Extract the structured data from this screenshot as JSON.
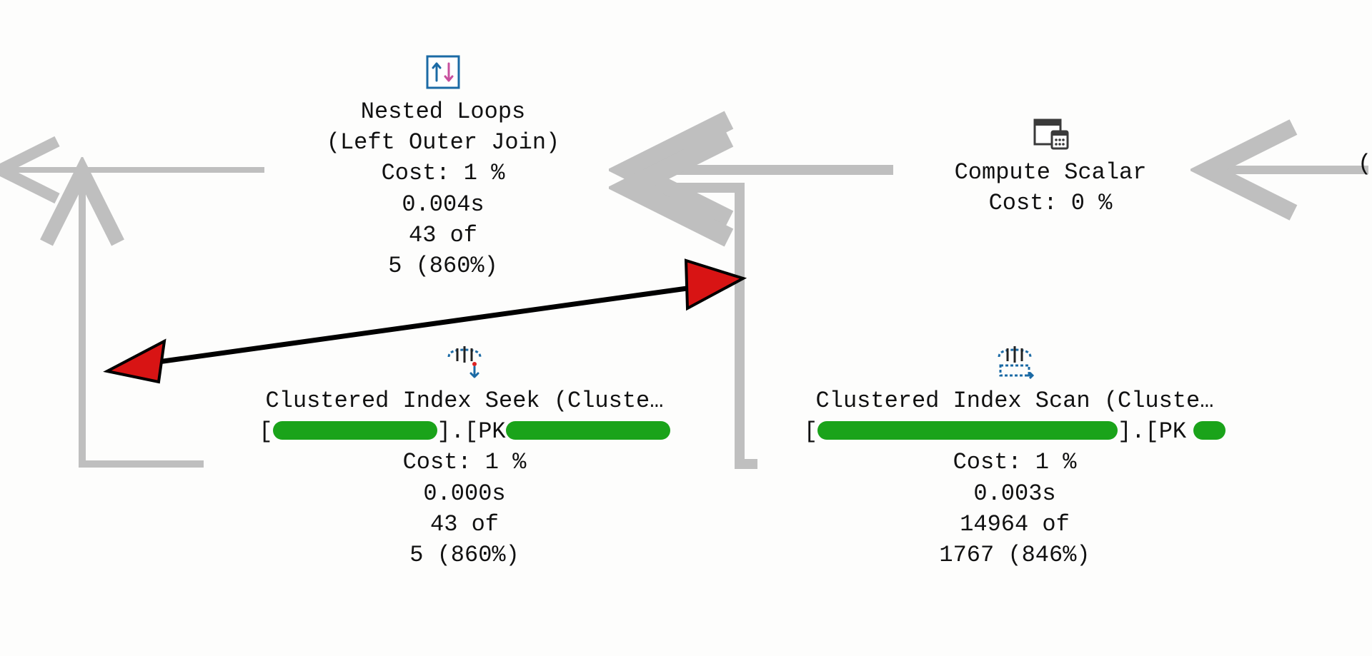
{
  "operators": {
    "nested_loops": {
      "title": "Nested Loops",
      "subtitle": "(Left Outer Join)",
      "cost": "Cost: 1 %",
      "time": "0.004s",
      "actual": "43 of",
      "estimate": "5 (860%)"
    },
    "compute_scalar": {
      "title": "Compute Scalar",
      "cost": "Cost: 0 %"
    },
    "index_seek": {
      "title": "Clustered Index Seek (Cluste…",
      "obj_prefix": "[",
      "obj_mid": "].[PK",
      "obj_suffix": "",
      "cost": "Cost: 1 %",
      "time": "0.000s",
      "actual": "43 of",
      "estimate": "5 (860%)"
    },
    "index_scan": {
      "title": "Clustered Index Scan (Cluste…",
      "obj_prefix": "[",
      "obj_mid": "].[PK",
      "obj_suffix": "",
      "cost": "Cost: 1 %",
      "time": "0.003s",
      "actual": "14964 of",
      "estimate": "1767 (846%)"
    }
  },
  "truncated_paren": "("
}
